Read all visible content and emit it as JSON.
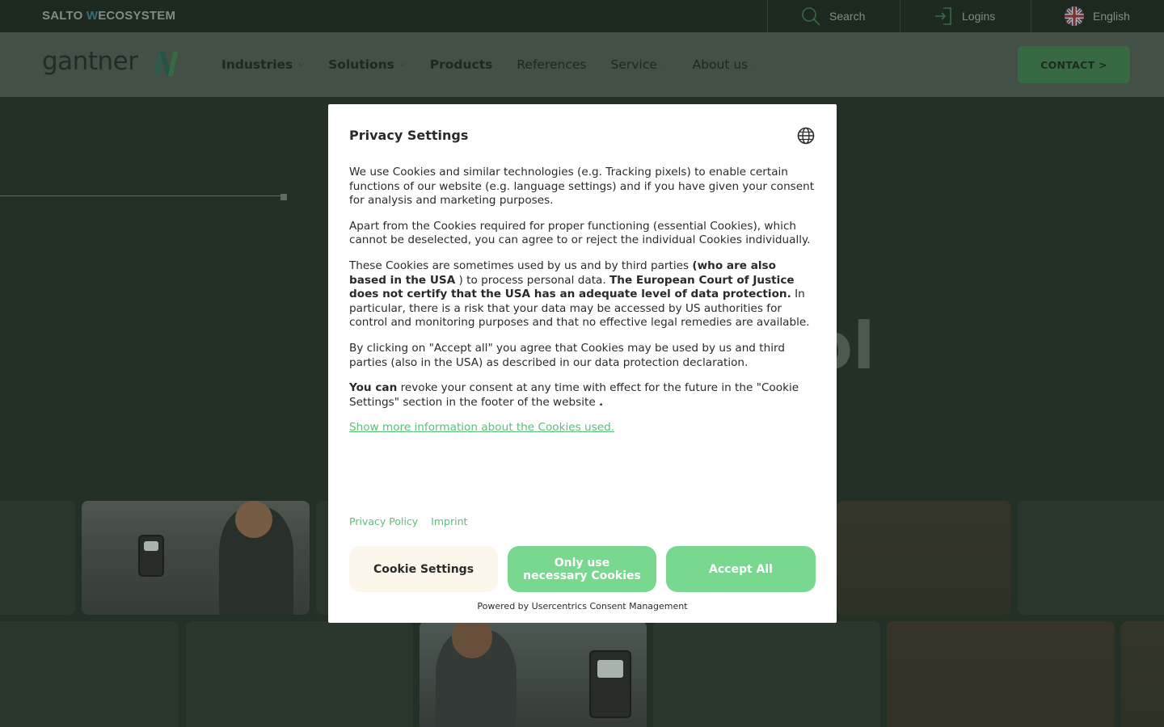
{
  "topbar": {
    "brand_prefix": "SALTO ",
    "brand_w": "W",
    "brand_suffix": "ECOSYSTEM",
    "search_label": "Search",
    "logins_label": "Logins",
    "language_label": "English"
  },
  "nav": {
    "logo_text": "gantner",
    "items": [
      {
        "label": "Industries"
      },
      {
        "label": "Solutions"
      },
      {
        "label": "Products"
      },
      {
        "label": "References"
      },
      {
        "label": "Service"
      },
      {
        "label": "About us"
      }
    ],
    "contact_label": "CONTACT >"
  },
  "hero": {
    "partial_text": "ol"
  },
  "modal": {
    "title": "Privacy Settings",
    "p1": "We use Cookies and similar technologies (e.g. Tracking pixels) to enable certain functions of our website (e.g. language settings) and if you have given your consent for analysis and marketing purposes.",
    "p2": "Apart from the Cookies required for proper functioning (essential Cookies), which cannot be deselected, you can agree to or reject the individual Cookies individually.",
    "p3_a": "These Cookies are sometimes used by us and by third parties ",
    "p3_b": "(who are also based in the USA",
    "p3_c": " ) to process personal data. ",
    "p3_d": "The European Court of Justice does not certify that the USA has an adequate level of data protection.",
    "p3_e": " In particular, there is a risk that your data may be accessed by US authorities for control and monitoring purposes and that no effective legal remedies are available.",
    "p4": "By clicking on \"Accept all\" you agree that Cookies may be used by us and third parties (also in the USA) as described in our data protection declaration.",
    "p5_a": "You can",
    "p5_b": " revoke your consent at any time with effect for the future in the \"Cookie Settings\" section in the footer of the website ",
    "p5_c": ".",
    "more_link": "Show more information about the Cookies used.",
    "privacy_policy": "Privacy Policy",
    "imprint": "Imprint",
    "btn_settings": "Cookie Settings",
    "btn_necessary": "Only use necessary Cookies",
    "btn_accept": "Accept All",
    "powered_by": "Powered by Usercentrics Consent Management"
  },
  "colors": {
    "accent_green": "#78d88f",
    "link_green": "#5bbf78",
    "contact_green": "#3f7a4d",
    "settings_bg": "#fdf6ea"
  }
}
